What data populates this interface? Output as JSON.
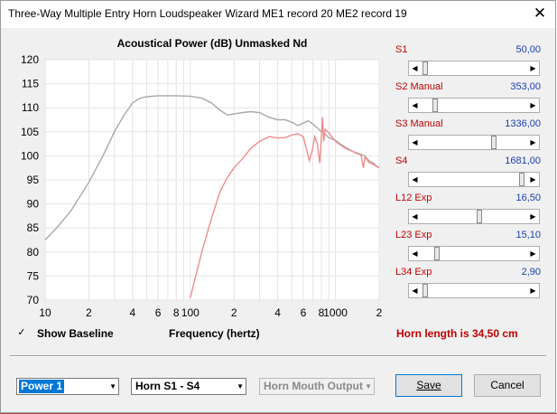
{
  "window": {
    "title": "Three-Way Multiple Entry Horn Loudspeaker Wizard   ME1 record 20    ME2 record 19",
    "close_glyph": "✕"
  },
  "sliders": [
    {
      "id": "s1",
      "label": "S1",
      "value": "50,00",
      "fraction": 0.02
    },
    {
      "id": "s2",
      "label": "S2 Manual",
      "value": "353,00",
      "fraction": 0.12
    },
    {
      "id": "s3",
      "label": "S3 Manual",
      "value": "1336,00",
      "fraction": 0.7
    },
    {
      "id": "s4",
      "label": "S4",
      "value": "1681,00",
      "fraction": 0.97
    },
    {
      "id": "l12",
      "label": "L12  Exp",
      "value": "16,50",
      "fraction": 0.55
    },
    {
      "id": "l23",
      "label": "L23  Exp",
      "value": "15,10",
      "fraction": 0.13
    },
    {
      "id": "l34",
      "label": "L34  Exp",
      "value": "2,90",
      "fraction": 0.02
    }
  ],
  "checkbox": {
    "label": "Show Baseline",
    "checked": true,
    "glyph": "✓"
  },
  "frequency_label": "Frequency (hertz)",
  "horn_length": "Horn length is 34,50 cm",
  "combos": {
    "power": {
      "value": "Power 1"
    },
    "horn": {
      "value": "Horn S1 - S4"
    },
    "mouth": {
      "value": "Horn Mouth Output"
    }
  },
  "buttons": {
    "save": "Save",
    "cancel": "Cancel"
  },
  "colors": {
    "baseline": "#a8a8a8",
    "horn": "#f08c8c",
    "label_red": "#c00000",
    "value_blue": "#1a3fb0",
    "grid": "#e4e4e4"
  },
  "icons": {
    "dropdown": "dropdown-arrow-icon",
    "close": "close-icon",
    "left_arrow": "left-arrow-icon",
    "right_arrow": "right-arrow-icon"
  },
  "chart_data": {
    "type": "line",
    "title": "Acoustical Power (dB)   Unmasked   Nd",
    "xlabel": "Frequency (hertz)",
    "ylabel": "",
    "xscale": "log",
    "xlim": [
      10,
      2000
    ],
    "ylim": [
      70,
      120
    ],
    "grid": true,
    "x_ticks": [
      {
        "v": 10,
        "label": "10"
      },
      {
        "v": 20,
        "label": "2"
      },
      {
        "v": 40,
        "label": "4"
      },
      {
        "v": 60,
        "label": "6"
      },
      {
        "v": 80,
        "label": "8"
      },
      {
        "v": 100,
        "label": "100"
      },
      {
        "v": 200,
        "label": "2"
      },
      {
        "v": 400,
        "label": "4"
      },
      {
        "v": 600,
        "label": "6"
      },
      {
        "v": 800,
        "label": "8"
      },
      {
        "v": 1000,
        "label": "1000"
      },
      {
        "v": 2000,
        "label": "2"
      }
    ],
    "y_ticks": [
      70,
      75,
      80,
      85,
      90,
      95,
      100,
      105,
      110,
      115,
      120
    ],
    "series": [
      {
        "name": "",
        "color": "#a8a8a8",
        "points": [
          [
            10,
            82.5
          ],
          [
            12,
            85
          ],
          [
            15,
            88.5
          ],
          [
            20,
            94.5
          ],
          [
            25,
            100
          ],
          [
            30,
            105
          ],
          [
            35,
            108.5
          ],
          [
            40,
            111
          ],
          [
            45,
            112
          ],
          [
            50,
            112.3
          ],
          [
            60,
            112.5
          ],
          [
            70,
            112.5
          ],
          [
            80,
            112.5
          ],
          [
            100,
            112.4
          ],
          [
            120,
            112
          ],
          [
            140,
            111
          ],
          [
            160,
            109.5
          ],
          [
            180,
            108.5
          ],
          [
            200,
            108.7
          ],
          [
            230,
            109
          ],
          [
            260,
            109.2
          ],
          [
            300,
            109
          ],
          [
            350,
            108
          ],
          [
            400,
            107.5
          ],
          [
            450,
            107.5
          ],
          [
            500,
            107
          ],
          [
            550,
            106.3
          ],
          [
            600,
            106.8
          ],
          [
            650,
            107.3
          ],
          [
            700,
            106.6
          ],
          [
            750,
            105.8
          ],
          [
            800,
            105
          ],
          [
            850,
            104.5
          ],
          [
            900,
            103.8
          ],
          [
            1000,
            103.2
          ],
          [
            1100,
            102.3
          ],
          [
            1200,
            101.6
          ],
          [
            1300,
            101
          ],
          [
            1400,
            100.6
          ],
          [
            1500,
            100.3
          ],
          [
            1600,
            99.9
          ],
          [
            1700,
            99
          ],
          [
            1800,
            98.6
          ],
          [
            1900,
            98
          ],
          [
            2000,
            97.5
          ]
        ]
      },
      {
        "name": "",
        "color": "#f08c8c",
        "points": [
          [
            100,
            70.5
          ],
          [
            120,
            80
          ],
          [
            140,
            87
          ],
          [
            160,
            92.5
          ],
          [
            180,
            95.5
          ],
          [
            200,
            97.5
          ],
          [
            230,
            99.5
          ],
          [
            260,
            101.5
          ],
          [
            300,
            103
          ],
          [
            350,
            104
          ],
          [
            400,
            103.7
          ],
          [
            450,
            103.8
          ],
          [
            500,
            104.3
          ],
          [
            550,
            104.6
          ],
          [
            600,
            104
          ],
          [
            630,
            101.5
          ],
          [
            660,
            99
          ],
          [
            690,
            101
          ],
          [
            720,
            104
          ],
          [
            750,
            102.5
          ],
          [
            780,
            98.5
          ],
          [
            800,
            104
          ],
          [
            815,
            108
          ],
          [
            830,
            103
          ],
          [
            850,
            105.5
          ],
          [
            900,
            104.8
          ],
          [
            1000,
            103
          ],
          [
            1100,
            102.1
          ],
          [
            1200,
            101.4
          ],
          [
            1300,
            101
          ],
          [
            1400,
            100.5
          ],
          [
            1500,
            100.2
          ],
          [
            1560,
            97.5
          ],
          [
            1600,
            99.8
          ],
          [
            1700,
            98.6
          ],
          [
            1800,
            98.3
          ],
          [
            1900,
            97.9
          ],
          [
            2000,
            97.5
          ]
        ]
      }
    ]
  }
}
